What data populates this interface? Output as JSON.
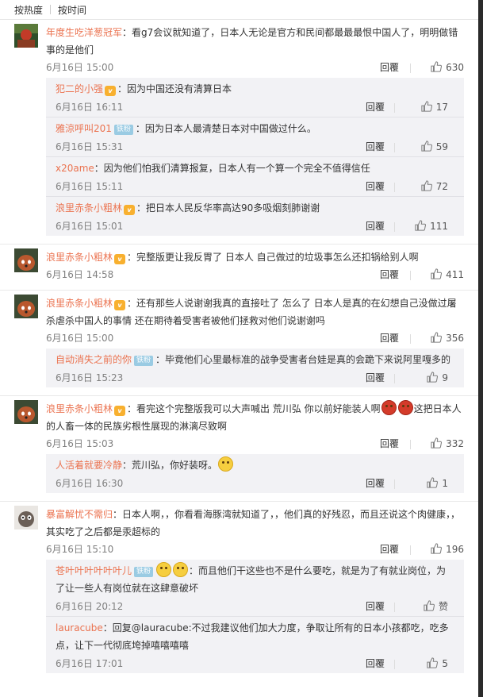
{
  "sort": {
    "hot": "按热度",
    "time": "按时间"
  },
  "colors": {
    "username": "#eb7350",
    "badge": "#9acbe3",
    "reply_bg": "#f2f2f5"
  },
  "icons": {
    "like": "thumbs-up-icon",
    "vip": "vip-badge-icon",
    "emoji": "emoji-icon"
  },
  "reply_label": "回覆",
  "comments": [
    {
      "user": "年度生吃洋葱冠军",
      "text": "：看g7会议就知道了，日本人无论是官方和民间都最最最恨中国人了，明明做错事的是他们",
      "time": "6月16日 15:00",
      "likes": "630",
      "replies": [
        {
          "user": "犯二的小强",
          "vip": true,
          "text": "：因为中国还没有清算日本",
          "time": "6月16日 16:11",
          "likes": "17"
        },
        {
          "user": "雅涼呼叫201",
          "badge": "铁粉",
          "text": "：因为日本人最清楚日本对中国做过什么。",
          "time": "6月16日 15:31",
          "likes": "59"
        },
        {
          "user": "x20ame",
          "text": "：因为他们怕我们清算报复，日本人有一个算一个完全不值得信任",
          "time": "6月16日 15:11",
          "likes": "72"
        },
        {
          "user": "浪里赤条小粗林",
          "vip": true,
          "text": "：把日本人民反华率高达90多吸烟刻肺谢谢",
          "time": "6月16日 15:01",
          "likes": "111"
        }
      ]
    },
    {
      "user": "浪里赤条小粗林",
      "vip": true,
      "text": "：完整版更让我反胃了 日本人 自己做过的垃圾事怎么还扣锅给别人啊",
      "time": "6月16日 14:58",
      "likes": "411",
      "replies": []
    },
    {
      "user": "浪里赤条小粗林",
      "vip": true,
      "text": "：还有那些人说谢谢我真的直接吐了 怎么了 日本人是真的在幻想自己没做过屠杀虐杀中国人的事情 还在期待着受害者被他们拯救对他们说谢谢吗",
      "time": "6月16日 15:00",
      "likes": "356",
      "replies": [
        {
          "user": "自动消失之前的你",
          "badge": "铁粉",
          "text": "：毕竟他们心里最标准的战争受害者台娃是真的会跪下来说阿里嘎多的",
          "time": "6月16日 15:23",
          "likes": "9"
        }
      ]
    },
    {
      "user": "浪里赤条小粗林",
      "vip": true,
      "text_a": "：看完这个完整版我可以大声喊出 荒川弘 你以前好能装人啊",
      "text_b": "这把日本人的人畜一体的民族劣根性展现的淋漓尽致啊",
      "time": "6月16日 15:03",
      "likes": "332",
      "replies": [
        {
          "user": "人活着就要冷静",
          "text": "：荒川弘，你好装呀。",
          "time": "6月16日 16:30",
          "likes": "1"
        }
      ]
    },
    {
      "user": "暴富解忧不需归",
      "text": "：日本人啊，，你看看海豚湾就知道了，，他们真的好残忍，而且还说这个肉健康，，其实吃了之后都是汞超标的",
      "time": "6月16日 15:10",
      "likes": "196",
      "replies": [
        {
          "user": "苍叶叶叶叶叶叶儿",
          "badge": "铁粉",
          "text": "：而且他们干这些也不是什么要吃，就是为了有就业岗位，为了让一些人有岗位就在这肆意破坏",
          "time": "6月16日 20:12",
          "likes": "赞"
        },
        {
          "user": "lauracube",
          "text": "：回复@lauracube:不过我建议他们加大力度，争取让所有的日本小孩都吃，吃多点，让下一代彻底垮掉嘻嘻嘻嘻",
          "time": "6月16日 17:01",
          "likes": "5"
        }
      ]
    }
  ]
}
